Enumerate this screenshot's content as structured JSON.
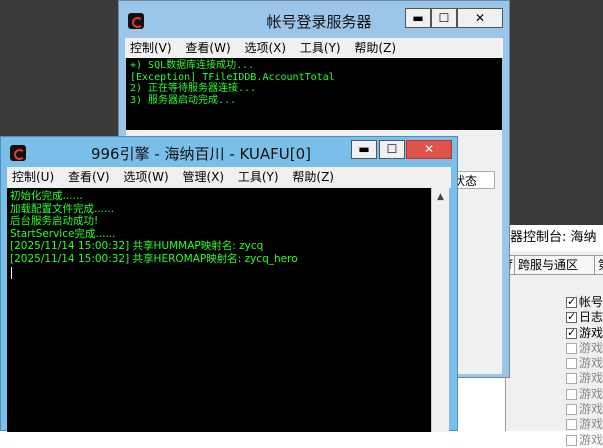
{
  "right_window": {
    "title": "器控制台: 海纳",
    "tabs": [
      "f",
      "跨服与通区",
      "第"
    ],
    "checklist": [
      {
        "label": "帐号",
        "checked": true
      },
      {
        "label": "日志",
        "checked": true
      },
      {
        "label": "游戏",
        "checked": true
      },
      {
        "label": "游戏",
        "checked": false
      },
      {
        "label": "游戏",
        "checked": false
      },
      {
        "label": "游戏",
        "checked": false
      },
      {
        "label": "游戏",
        "checked": false
      },
      {
        "label": "游戏",
        "checked": false
      },
      {
        "label": "游戏",
        "checked": false
      },
      {
        "label": "游戏",
        "checked": false
      }
    ]
  },
  "login_window": {
    "title": "帐号登录服务器",
    "buttons": {
      "minimize": "▬",
      "maximize": "☐",
      "close": "✕"
    },
    "menu": [
      "控制(V)",
      "查看(W)",
      "选项(X)",
      "工具(Y)",
      "帮助(Z)"
    ],
    "console_lines": [
      "+) SQL数据库连接成功...",
      "[Exception] TFileIDDB.AccountTotal",
      "2) 正在等待服务器连接...",
      "3) 服务器启动完成..."
    ],
    "status_header": "状态"
  },
  "kuafu_window": {
    "title": "996引擎 - 海纳百川 - KUAFU[0]",
    "buttons": {
      "minimize": "▬",
      "maximize": "☐",
      "close": "✕"
    },
    "menu": [
      "控制(U)",
      "查看(V)",
      "选项(W)",
      "管理(X)",
      "工具(Y)",
      "帮助(Z)"
    ],
    "console_lines": [
      "初始化完成......",
      "加载配置文件完成......",
      "后台服务启动成功!",
      "StartService完成......",
      "[2025/11/14 15:00:32] 共享HUMMAP映射名: zycq",
      "[2025/11/14 15:00:32] 共享HEROMAP映射名: zycq_hero"
    ],
    "scroll_up": "▲"
  },
  "colors": {
    "console_text": "#2bff2b",
    "console_bg": "#000000",
    "active_title": "#79bfe9",
    "inactive_title": "#9bc6ea",
    "close_button": "#e0534b"
  }
}
